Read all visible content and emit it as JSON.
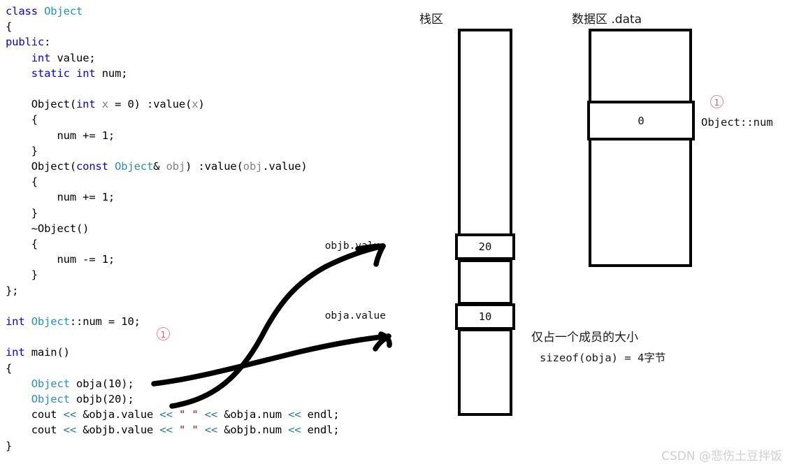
{
  "code": {
    "lines": [
      [
        {
          "t": "class ",
          "c": "kw"
        },
        {
          "t": "Object",
          "c": "type"
        }
      ],
      [
        {
          "t": "{",
          "c": "plain"
        }
      ],
      [
        {
          "t": "public",
          "c": "kw"
        },
        {
          "t": ":",
          "c": "plain"
        }
      ],
      [
        {
          "t": "    ",
          "c": "plain"
        },
        {
          "t": "int",
          "c": "kw"
        },
        {
          "t": " value;",
          "c": "plain"
        }
      ],
      [
        {
          "t": "    ",
          "c": "plain"
        },
        {
          "t": "static",
          "c": "kw"
        },
        {
          "t": " ",
          "c": "plain"
        },
        {
          "t": "int",
          "c": "kw"
        },
        {
          "t": " num;",
          "c": "plain"
        }
      ],
      [],
      [
        {
          "t": "    Object(",
          "c": "plain"
        },
        {
          "t": "int",
          "c": "kw"
        },
        {
          "t": " ",
          "c": "plain"
        },
        {
          "t": "x",
          "c": "param"
        },
        {
          "t": " = 0) :value(",
          "c": "plain"
        },
        {
          "t": "x",
          "c": "param"
        },
        {
          "t": ")",
          "c": "plain"
        }
      ],
      [
        {
          "t": "    {",
          "c": "plain"
        }
      ],
      [
        {
          "t": "        num += 1;",
          "c": "plain"
        }
      ],
      [
        {
          "t": "    }",
          "c": "plain"
        }
      ],
      [
        {
          "t": "    Object(",
          "c": "plain"
        },
        {
          "t": "const",
          "c": "kw"
        },
        {
          "t": " ",
          "c": "plain"
        },
        {
          "t": "Object",
          "c": "type"
        },
        {
          "t": "& ",
          "c": "plain"
        },
        {
          "t": "obj",
          "c": "param"
        },
        {
          "t": ") :value(",
          "c": "plain"
        },
        {
          "t": "obj",
          "c": "param"
        },
        {
          "t": ".value)",
          "c": "plain"
        }
      ],
      [
        {
          "t": "    {",
          "c": "plain"
        }
      ],
      [
        {
          "t": "        num += 1;",
          "c": "plain"
        }
      ],
      [
        {
          "t": "    }",
          "c": "plain"
        }
      ],
      [
        {
          "t": "    ~Object()",
          "c": "plain"
        }
      ],
      [
        {
          "t": "    {",
          "c": "plain"
        }
      ],
      [
        {
          "t": "        num -= 1;",
          "c": "plain"
        }
      ],
      [
        {
          "t": "    }",
          "c": "plain"
        }
      ],
      [
        {
          "t": "};",
          "c": "plain"
        }
      ],
      [],
      [
        {
          "t": "int",
          "c": "kw"
        },
        {
          "t": " ",
          "c": "plain"
        },
        {
          "t": "Object",
          "c": "type"
        },
        {
          "t": "::num = 10;",
          "c": "plain"
        }
      ],
      [],
      [
        {
          "t": "int",
          "c": "kw"
        },
        {
          "t": " main()",
          "c": "plain"
        }
      ],
      [
        {
          "t": "{",
          "c": "plain"
        }
      ],
      [
        {
          "t": "    ",
          "c": "plain"
        },
        {
          "t": "Object",
          "c": "type"
        },
        {
          "t": " obja(10);",
          "c": "plain"
        }
      ],
      [
        {
          "t": "    ",
          "c": "plain"
        },
        {
          "t": "Object",
          "c": "type"
        },
        {
          "t": " objb(20);",
          "c": "plain"
        }
      ],
      [
        {
          "t": "    cout ",
          "c": "plain"
        },
        {
          "t": "<<",
          "c": "op"
        },
        {
          "t": " &obja.value ",
          "c": "plain"
        },
        {
          "t": "<<",
          "c": "op"
        },
        {
          "t": " ",
          "c": "plain"
        },
        {
          "t": "\" \"",
          "c": "str"
        },
        {
          "t": " ",
          "c": "plain"
        },
        {
          "t": "<<",
          "c": "op"
        },
        {
          "t": " &obja.num ",
          "c": "plain"
        },
        {
          "t": "<<",
          "c": "op"
        },
        {
          "t": " endl;",
          "c": "plain"
        }
      ],
      [
        {
          "t": "    cout ",
          "c": "plain"
        },
        {
          "t": "<<",
          "c": "op"
        },
        {
          "t": " &objb.value ",
          "c": "plain"
        },
        {
          "t": "<<",
          "c": "op"
        },
        {
          "t": " ",
          "c": "plain"
        },
        {
          "t": "\" \"",
          "c": "str"
        },
        {
          "t": " ",
          "c": "plain"
        },
        {
          "t": "<<",
          "c": "op"
        },
        {
          "t": " &objb.num ",
          "c": "plain"
        },
        {
          "t": "<<",
          "c": "op"
        },
        {
          "t": " endl;",
          "c": "plain"
        }
      ],
      [
        {
          "t": "}",
          "c": "plain"
        }
      ]
    ],
    "marker_after_static_init": "1"
  },
  "stack_region": {
    "title": "栈区",
    "slots": [
      {
        "label": "objb.value",
        "value": "20"
      },
      {
        "label": "obja.value",
        "value": "10"
      }
    ]
  },
  "data_region": {
    "title": "数据区 .data",
    "cell_value": "0",
    "marker": "1",
    "annotation": "Object::num"
  },
  "notes": {
    "line1": "仅占一个成员的大小",
    "line2": "sizeof(obja) = 4字节"
  },
  "watermark": "CSDN @悲伤土豆拌饭",
  "colors": {
    "keyword": "#0000ff",
    "type": "#2b91af",
    "param": "#808080",
    "operator": "#2b7a8c",
    "string": "#a31515",
    "marker_red": "#e05a5a",
    "box_border": "#000000",
    "watermark": "#cfcfcf"
  }
}
